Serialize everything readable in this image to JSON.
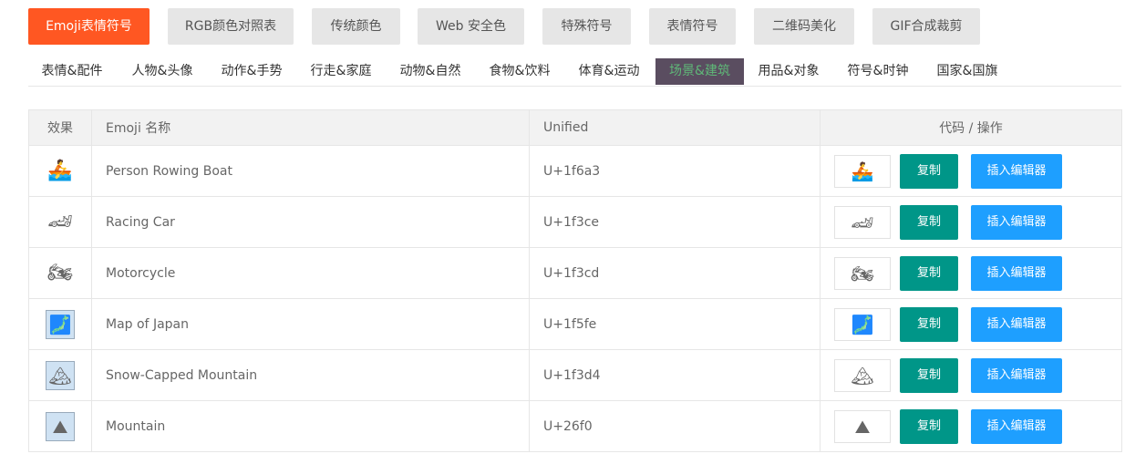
{
  "top_nav": [
    {
      "label": "Emoji表情符号",
      "active": true
    },
    {
      "label": "RGB颜色对照表",
      "active": false
    },
    {
      "label": "传统颜色",
      "active": false
    },
    {
      "label": "Web 安全色",
      "active": false
    },
    {
      "label": "特殊符号",
      "active": false
    },
    {
      "label": "表情符号",
      "active": false
    },
    {
      "label": "二维码美化",
      "active": false
    },
    {
      "label": "GIF合成裁剪",
      "active": false
    }
  ],
  "categories": [
    {
      "label": "表情&配件",
      "active": false
    },
    {
      "label": "人物&头像",
      "active": false
    },
    {
      "label": "动作&手势",
      "active": false
    },
    {
      "label": "行走&家庭",
      "active": false
    },
    {
      "label": "动物&自然",
      "active": false
    },
    {
      "label": "食物&饮料",
      "active": false
    },
    {
      "label": "体育&运动",
      "active": false
    },
    {
      "label": "场景&建筑",
      "active": true
    },
    {
      "label": "用品&对象",
      "active": false
    },
    {
      "label": "符号&时钟",
      "active": false
    },
    {
      "label": "国家&国旗",
      "active": false
    }
  ],
  "table": {
    "headers": {
      "effect": "效果",
      "name": "Emoji 名称",
      "unified": "Unified",
      "code": "代码 / 操作"
    },
    "copy_label": "复制",
    "insert_label": "插入编辑器",
    "rows": [
      {
        "emoji": "🚣",
        "name": "Person Rowing Boat",
        "unified": "U+1f6a3",
        "framed": false
      },
      {
        "emoji": "🏎",
        "name": "Racing Car",
        "unified": "U+1f3ce",
        "framed": false
      },
      {
        "emoji": "🏍",
        "name": "Motorcycle",
        "unified": "U+1f3cd",
        "framed": false
      },
      {
        "emoji": "🗾",
        "name": "Map of Japan",
        "unified": "U+1f5fe",
        "framed": true
      },
      {
        "emoji": "🏔",
        "name": "Snow-Capped Mountain",
        "unified": "U+1f3d4",
        "framed": true
      },
      {
        "emoji": "⛰",
        "name": "Mountain",
        "unified": "U+26f0",
        "framed": true
      }
    ]
  },
  "colors": {
    "accent_orange": "#ff5722",
    "copy_green": "#009688",
    "insert_blue": "#1e9fff",
    "active_tab_bg": "#5a4d60",
    "active_tab_text": "#5fb878"
  }
}
